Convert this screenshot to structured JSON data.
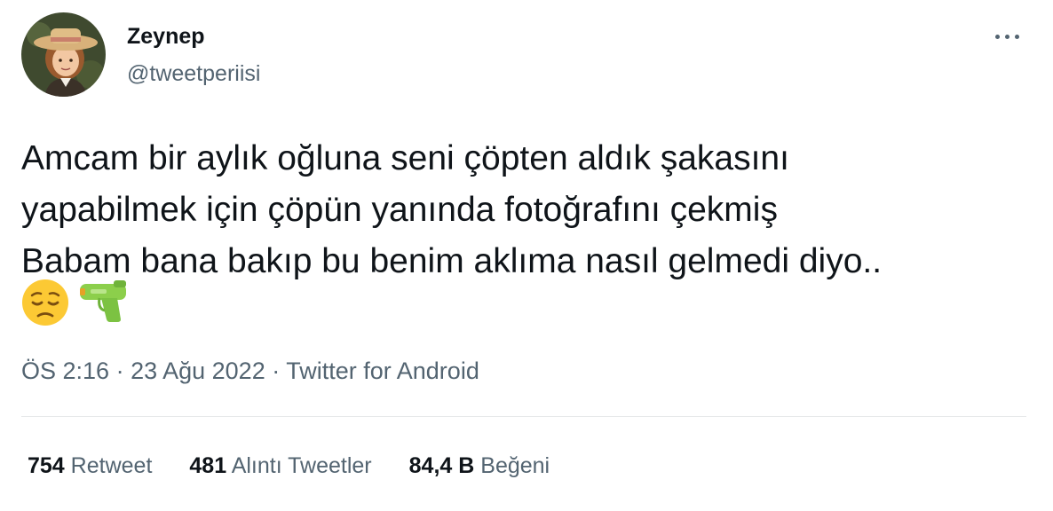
{
  "user": {
    "display_name": "Zeynep",
    "handle": "@tweetperiisi"
  },
  "tweet": {
    "lines": [
      "Amcam bir aylık oğluna seni çöpten aldık şakasını",
      "yapabilmek için çöpün yanında fotoğrafını çekmiş",
      "Babam bana bakıp bu benim aklıma nasıl gelmedi diyo.."
    ],
    "emojis": [
      "pensive-face-emoji",
      "water-pistol-emoji"
    ]
  },
  "meta": {
    "time": "ÖS 2:16",
    "separator1": " · ",
    "date": "23 Ağu 2022",
    "separator2": " · ",
    "source": "Twitter for Android"
  },
  "stats": {
    "retweets_count": "754",
    "retweets_label": "Retweet",
    "quotes_count": "481",
    "quotes_label": "Alıntı Tweetler",
    "likes_count": "84,4 B",
    "likes_label": "Beğeni"
  },
  "colors": {
    "text_primary": "#0f1419",
    "text_secondary": "#536471",
    "divider": "#e7e9ea"
  }
}
